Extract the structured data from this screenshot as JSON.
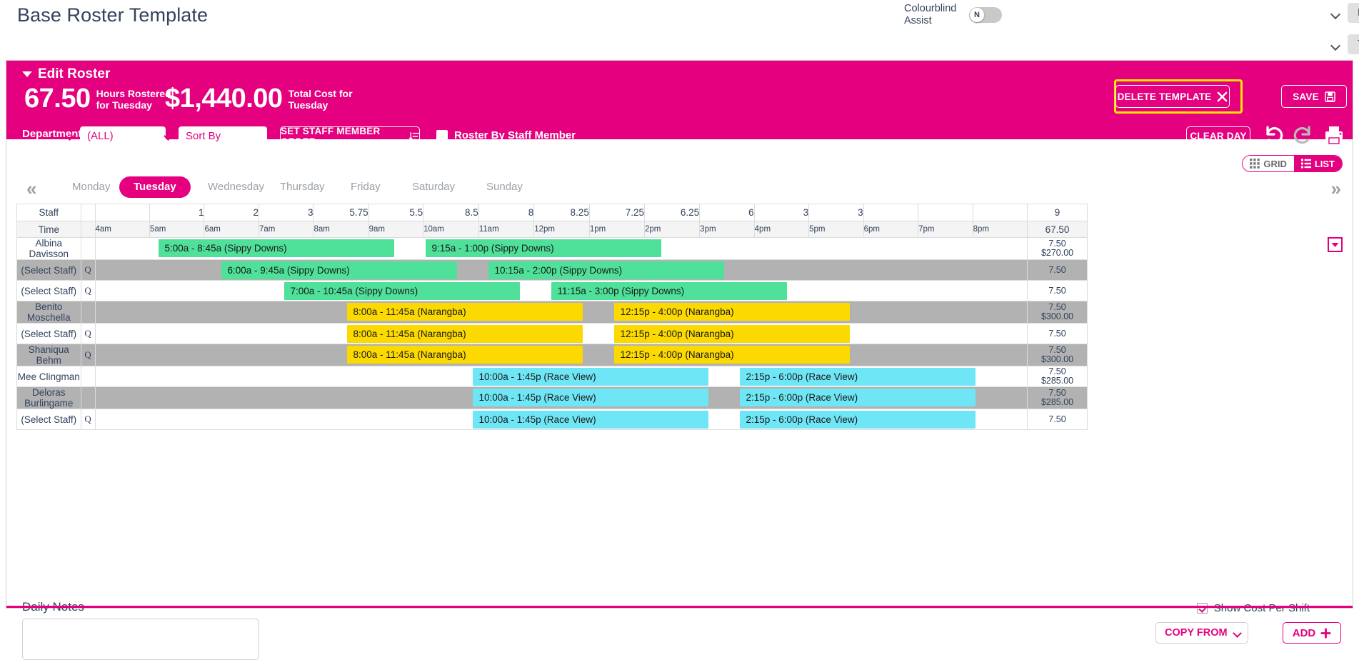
{
  "header": {
    "app_title": "Base Roster Template",
    "colourblind_label": "Colourblind Assist",
    "colourblind_state": "N",
    "company_value": "Mobile App Demo",
    "view_value": "TEMPLATE"
  },
  "panel": {
    "title": "Edit Roster",
    "hours_value": "67.50",
    "hours_label": "Hours Rostered for Tuesday",
    "cost_value": "$1,440.00",
    "cost_label": "Total Cost for Tuesday",
    "department_label": "Department:",
    "department_value": "(ALL)",
    "sort_by_value": "Sort By",
    "set_staff_member_order": "SET STAFF MEMBER ORDER",
    "roster_by_staff_member": "Roster By Staff Member",
    "delete_template": "DELETE TEMPLATE",
    "save": "SAVE",
    "clear_day": "CLEAR DAY"
  },
  "view_toggle": {
    "grid": "GRID",
    "list": "LIST",
    "active": "GRID"
  },
  "days": [
    {
      "label": "Monday",
      "active": false
    },
    {
      "label": "Tuesday",
      "active": true
    },
    {
      "label": "Wednesday",
      "active": false
    },
    {
      "label": "Thursday",
      "active": false
    },
    {
      "label": "Friday",
      "active": false
    },
    {
      "label": "Saturday",
      "active": false
    },
    {
      "label": "Sunday",
      "active": false
    }
  ],
  "grid": {
    "staff_header": "Staff",
    "time_header": "Time",
    "hour_labels": [
      "4am",
      "5am",
      "6am",
      "7am",
      "8am",
      "9am",
      "10am",
      "11am",
      "12pm",
      "1pm",
      "2pm",
      "3pm",
      "4pm",
      "5pm",
      "6pm",
      "7pm",
      "8pm"
    ],
    "staff_counts": [
      "",
      "1",
      "2",
      "3",
      "5.75",
      "5.5",
      "8.5",
      "8",
      "8.25",
      "7.25",
      "6.25",
      "6",
      "3",
      "3",
      "",
      "",
      ""
    ],
    "total_staff": "9",
    "total_hours": "67.50"
  },
  "rows": [
    {
      "name": "Albina Davisson",
      "has_q": false,
      "alt": false,
      "hours": "7.50",
      "cost": "$270.00",
      "shifts": [
        {
          "label": "5:00a - 8:45a (Sippy Downs)",
          "start": 5.0,
          "end": 8.75,
          "colour": "#4fe09a"
        },
        {
          "label": "9:15a - 1:00p (Sippy Downs)",
          "start": 9.25,
          "end": 13.0,
          "colour": "#4fe09a"
        }
      ]
    },
    {
      "name": "(Select Staff)",
      "has_q": true,
      "alt": true,
      "hours": "7.50",
      "cost": "",
      "shifts": [
        {
          "label": "6:00a - 9:45a (Sippy Downs)",
          "start": 6.0,
          "end": 9.75,
          "colour": "#4fe09a"
        },
        {
          "label": "10:15a - 2:00p (Sippy Downs)",
          "start": 10.25,
          "end": 14.0,
          "colour": "#4fe09a"
        }
      ]
    },
    {
      "name": "(Select Staff)",
      "has_q": true,
      "alt": false,
      "hours": "7.50",
      "cost": "",
      "shifts": [
        {
          "label": "7:00a - 10:45a (Sippy Downs)",
          "start": 7.0,
          "end": 10.75,
          "colour": "#4fe09a"
        },
        {
          "label": "11:15a - 3:00p (Sippy Downs)",
          "start": 11.25,
          "end": 15.0,
          "colour": "#4fe09a"
        }
      ]
    },
    {
      "name": "Benito Moschella",
      "has_q": false,
      "alt": true,
      "hours": "7.50",
      "cost": "$300.00",
      "shifts": [
        {
          "label": "8:00a - 11:45a (Narangba)",
          "start": 8.0,
          "end": 11.75,
          "colour": "#fcd900"
        },
        {
          "label": "12:15p - 4:00p (Narangba)",
          "start": 12.25,
          "end": 16.0,
          "colour": "#fcd900"
        }
      ]
    },
    {
      "name": "(Select Staff)",
      "has_q": true,
      "alt": false,
      "hours": "7.50",
      "cost": "",
      "shifts": [
        {
          "label": "8:00a - 11:45a (Narangba)",
          "start": 8.0,
          "end": 11.75,
          "colour": "#fcd900"
        },
        {
          "label": "12:15p - 4:00p (Narangba)",
          "start": 12.25,
          "end": 16.0,
          "colour": "#fcd900"
        }
      ]
    },
    {
      "name": "Shaniqua Behm",
      "has_q": true,
      "alt": true,
      "hours": "7.50",
      "cost": "$300.00",
      "shifts": [
        {
          "label": "8:00a - 11:45a (Narangba)",
          "start": 8.0,
          "end": 11.75,
          "colour": "#fcd900"
        },
        {
          "label": "12:15p - 4:00p (Narangba)",
          "start": 12.25,
          "end": 16.0,
          "colour": "#fcd900"
        }
      ]
    },
    {
      "name": "Mee Clingman",
      "has_q": false,
      "alt": false,
      "hours": "7.50",
      "cost": "$285.00",
      "shifts": [
        {
          "label": "10:00a - 1:45p (Race View)",
          "start": 10.0,
          "end": 13.75,
          "colour": "#6fe6f5"
        },
        {
          "label": "2:15p - 6:00p (Race View)",
          "start": 14.25,
          "end": 18.0,
          "colour": "#6fe6f5"
        }
      ]
    },
    {
      "name": "Deloras Burlingame",
      "has_q": false,
      "alt": true,
      "hours": "7.50",
      "cost": "$285.00",
      "shifts": [
        {
          "label": "10:00a - 1:45p (Race View)",
          "start": 10.0,
          "end": 13.75,
          "colour": "#6fe6f5"
        },
        {
          "label": "2:15p - 6:00p (Race View)",
          "start": 14.25,
          "end": 18.0,
          "colour": "#6fe6f5"
        }
      ]
    },
    {
      "name": "(Select Staff)",
      "has_q": true,
      "alt": false,
      "hours": "7.50",
      "cost": "",
      "shifts": [
        {
          "label": "10:00a - 1:45p (Race View)",
          "start": 10.0,
          "end": 13.75,
          "colour": "#6fe6f5"
        },
        {
          "label": "2:15p - 6:00p (Race View)",
          "start": 14.25,
          "end": 18.0,
          "colour": "#6fe6f5"
        }
      ]
    }
  ],
  "footer": {
    "daily_notes_label": "Daily Notes",
    "daily_notes_value": "",
    "show_cost_per_shift": "Show Cost Per Shift",
    "copy_from": "COPY FROM",
    "add": "ADD"
  },
  "colors": {
    "brand_pink": "#e4007f",
    "highlight_yellow": "#ffe600",
    "shift_green": "#4fe09a",
    "shift_yellow": "#fcd900",
    "shift_cyan": "#6fe6f5",
    "alt_row_grey": "#b2b2b2"
  }
}
